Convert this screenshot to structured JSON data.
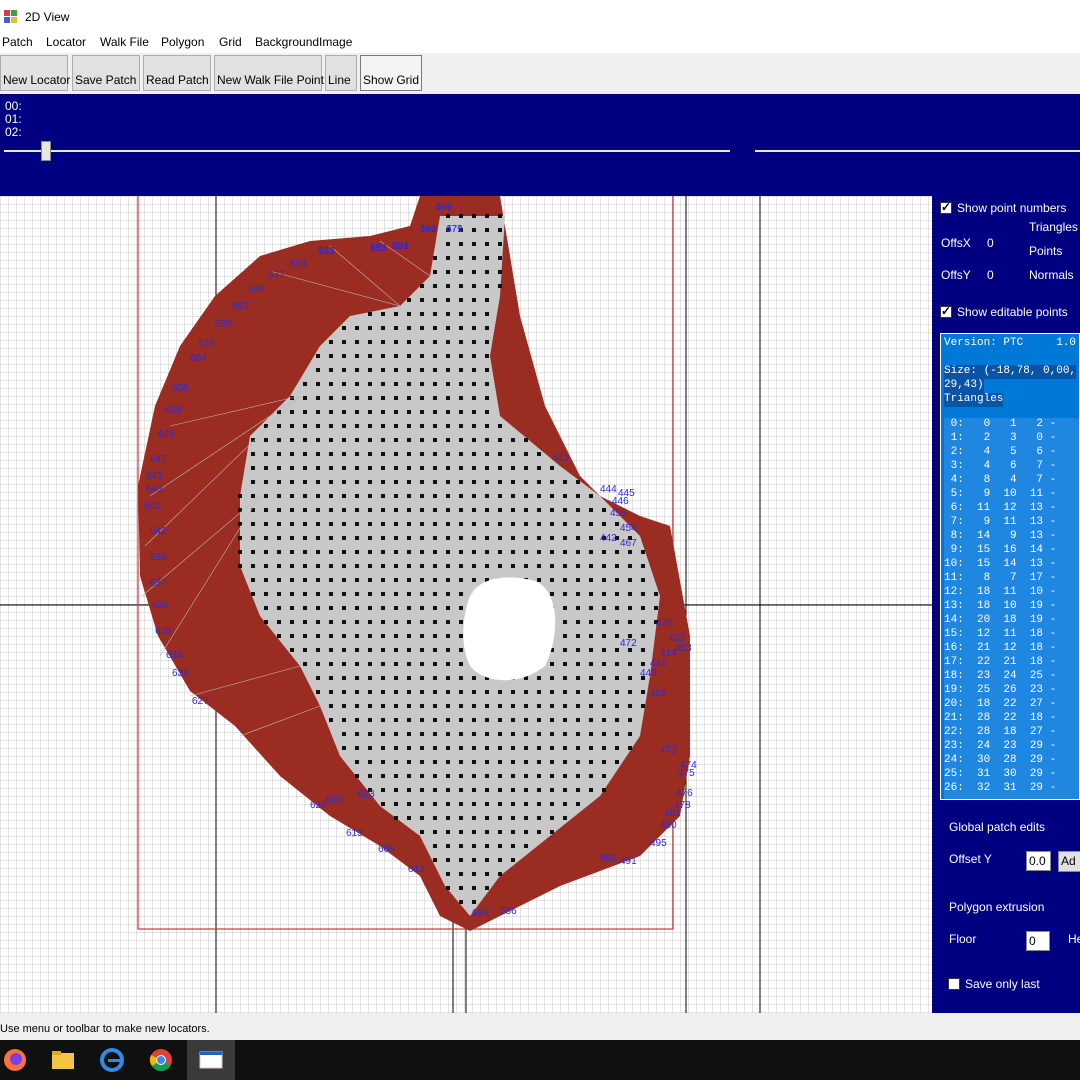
{
  "window": {
    "title": "2D View"
  },
  "menu": [
    "Patch",
    "Locator",
    "Walk File",
    "Polygon",
    "Grid",
    "BackgroundImage"
  ],
  "toolbar": {
    "new_locator": "New Locator",
    "save_patch": "Save Patch",
    "read_patch": "Read Patch",
    "new_walk_point": "New Walk File Point",
    "line": "Line",
    "show_grid": "Show Grid"
  },
  "top_lines": [
    "00:",
    "01:",
    "02:"
  ],
  "right_panel": {
    "show_point_numbers": "Show point numbers",
    "triangles": "Triangles",
    "offsx_label": "OffsX",
    "offsx_value": "0",
    "points": "Points",
    "offsy_label": "OffsY",
    "offsy_value": "0",
    "normals": "Normals",
    "show_editable_points": "Show editable points",
    "global_patch_edits": "Global patch edits",
    "offset_y_label": "Offset Y",
    "offset_y_value": "0.0",
    "add_button": "Ad",
    "polygon_extrusion": "Polygon extrusion",
    "floor_label": "Floor",
    "floor_value": "0",
    "height_label": "He",
    "save_only_last": "Save only last"
  },
  "info": {
    "version": "Version: PTC     1.0",
    "size1": "Size: (-18,78, 0,00,",
    "size2": "29,43)",
    "triangles_header": "Triangles",
    "rows": [
      " 0:   0   1   2 -",
      " 1:   2   3   0 -",
      " 2:   4   5   6 -",
      " 3:   4   6   7 -",
      " 4:   8   4   7 -",
      " 5:   9  10  11 -",
      " 6:  11  12  13 -",
      " 7:   9  11  13 -",
      " 8:  14   9  13 -",
      " 9:  15  16  14 -",
      "10:  15  14  13 -",
      "11:   8   7  17 -",
      "12:  18  11  10 -",
      "13:  18  10  19 -",
      "14:  20  18  19 -",
      "15:  12  11  18 -",
      "16:  21  12  18 -",
      "17:  22  21  18 -",
      "18:  23  24  25 -",
      "19:  25  26  23 -",
      "20:  18  22  27 -",
      "21:  28  22  18 -",
      "22:  28  18  27 -",
      "23:  24  23  29 -",
      "24:  30  28  29 -",
      "25:  31  30  29 -",
      "26:  32  31  29 -"
    ]
  },
  "canvas_labels": [
    "666",
    "671",
    "672",
    "573",
    "588",
    "584",
    "662",
    "577",
    "574",
    "589",
    "603",
    "580",
    "579",
    "604",
    "605",
    "649",
    "646",
    "647",
    "645",
    "643",
    "642",
    "641",
    "638",
    "637",
    "636",
    "635",
    "634",
    "633",
    "627",
    "626",
    "623",
    "600",
    "613",
    "606",
    "612",
    "699",
    "586",
    "501",
    "491",
    "495",
    "480",
    "481",
    "478",
    "476",
    "475",
    "474",
    "473",
    "472",
    "470",
    "467",
    "454",
    "455",
    "446",
    "445",
    "444",
    "443",
    "442",
    "441",
    "440",
    "433",
    "414",
    "453",
    "458",
    "468",
    "479",
    "450",
    "451",
    "452",
    "461"
  ],
  "status": "Use menu or toolbar to make new locators.",
  "taskbar": [
    "firefox-icon",
    "file-explorer-icon",
    "edge-icon",
    "chrome-icon",
    "app-window-icon"
  ],
  "colors": {
    "patch_fill": "#9b2c22",
    "mesh_fill": "#c8c8c8",
    "number_color": "#2b2bd6",
    "accent": "#000080"
  }
}
